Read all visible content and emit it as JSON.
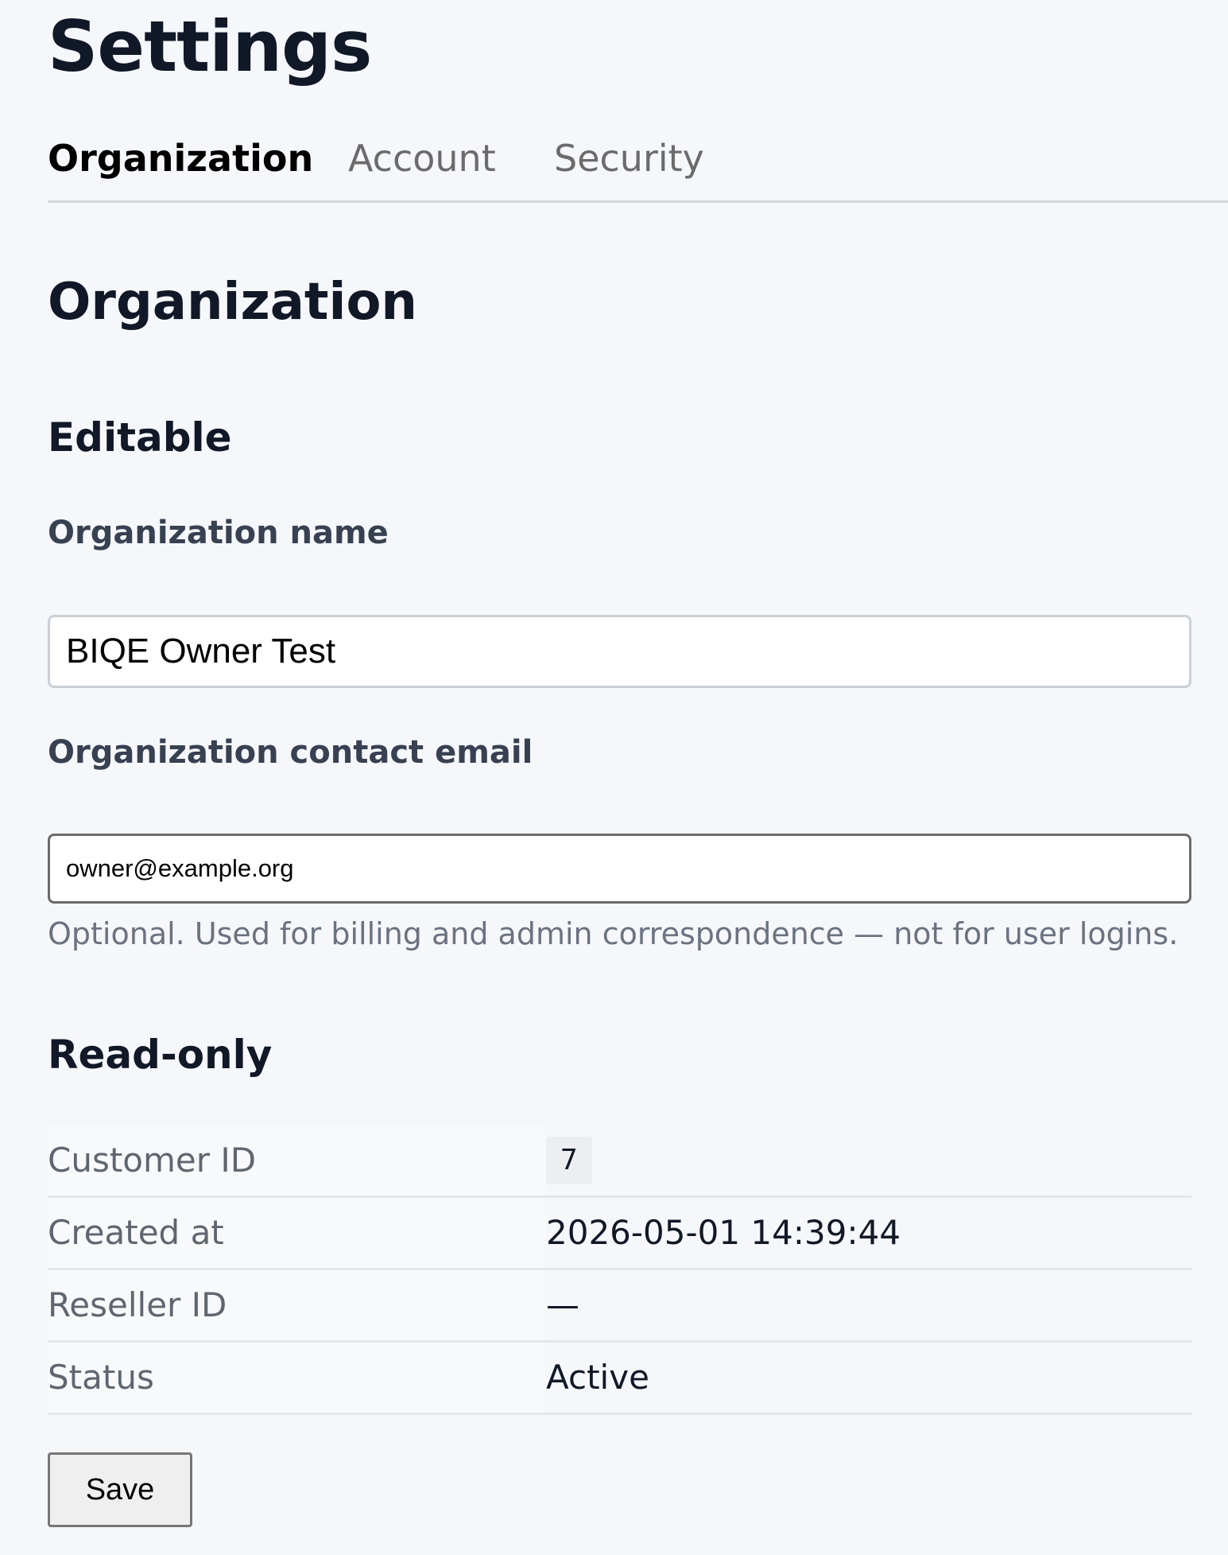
{
  "header": {
    "title": "Settings"
  },
  "tabs": [
    {
      "label": "Organization",
      "active": true
    },
    {
      "label": "Account",
      "active": false
    },
    {
      "label": "Security",
      "active": false
    }
  ],
  "section": {
    "title": "Organization",
    "editable": {
      "title": "Editable",
      "org_name": {
        "label": "Organization name",
        "value": "BIQE Owner Test"
      },
      "contact_email": {
        "label": "Organization contact email",
        "value": "owner@example.org",
        "help": "Optional. Used for billing and admin correspondence — not for user logins."
      }
    },
    "readonly": {
      "title": "Read-only",
      "rows": [
        {
          "label": "Customer ID",
          "value": "7"
        },
        {
          "label": "Created at",
          "value": "2026-05-01 14:39:44"
        },
        {
          "label": "Reseller ID",
          "value": "—"
        },
        {
          "label": "Status",
          "value": "Active"
        }
      ]
    }
  },
  "actions": {
    "save_label": "Save"
  }
}
